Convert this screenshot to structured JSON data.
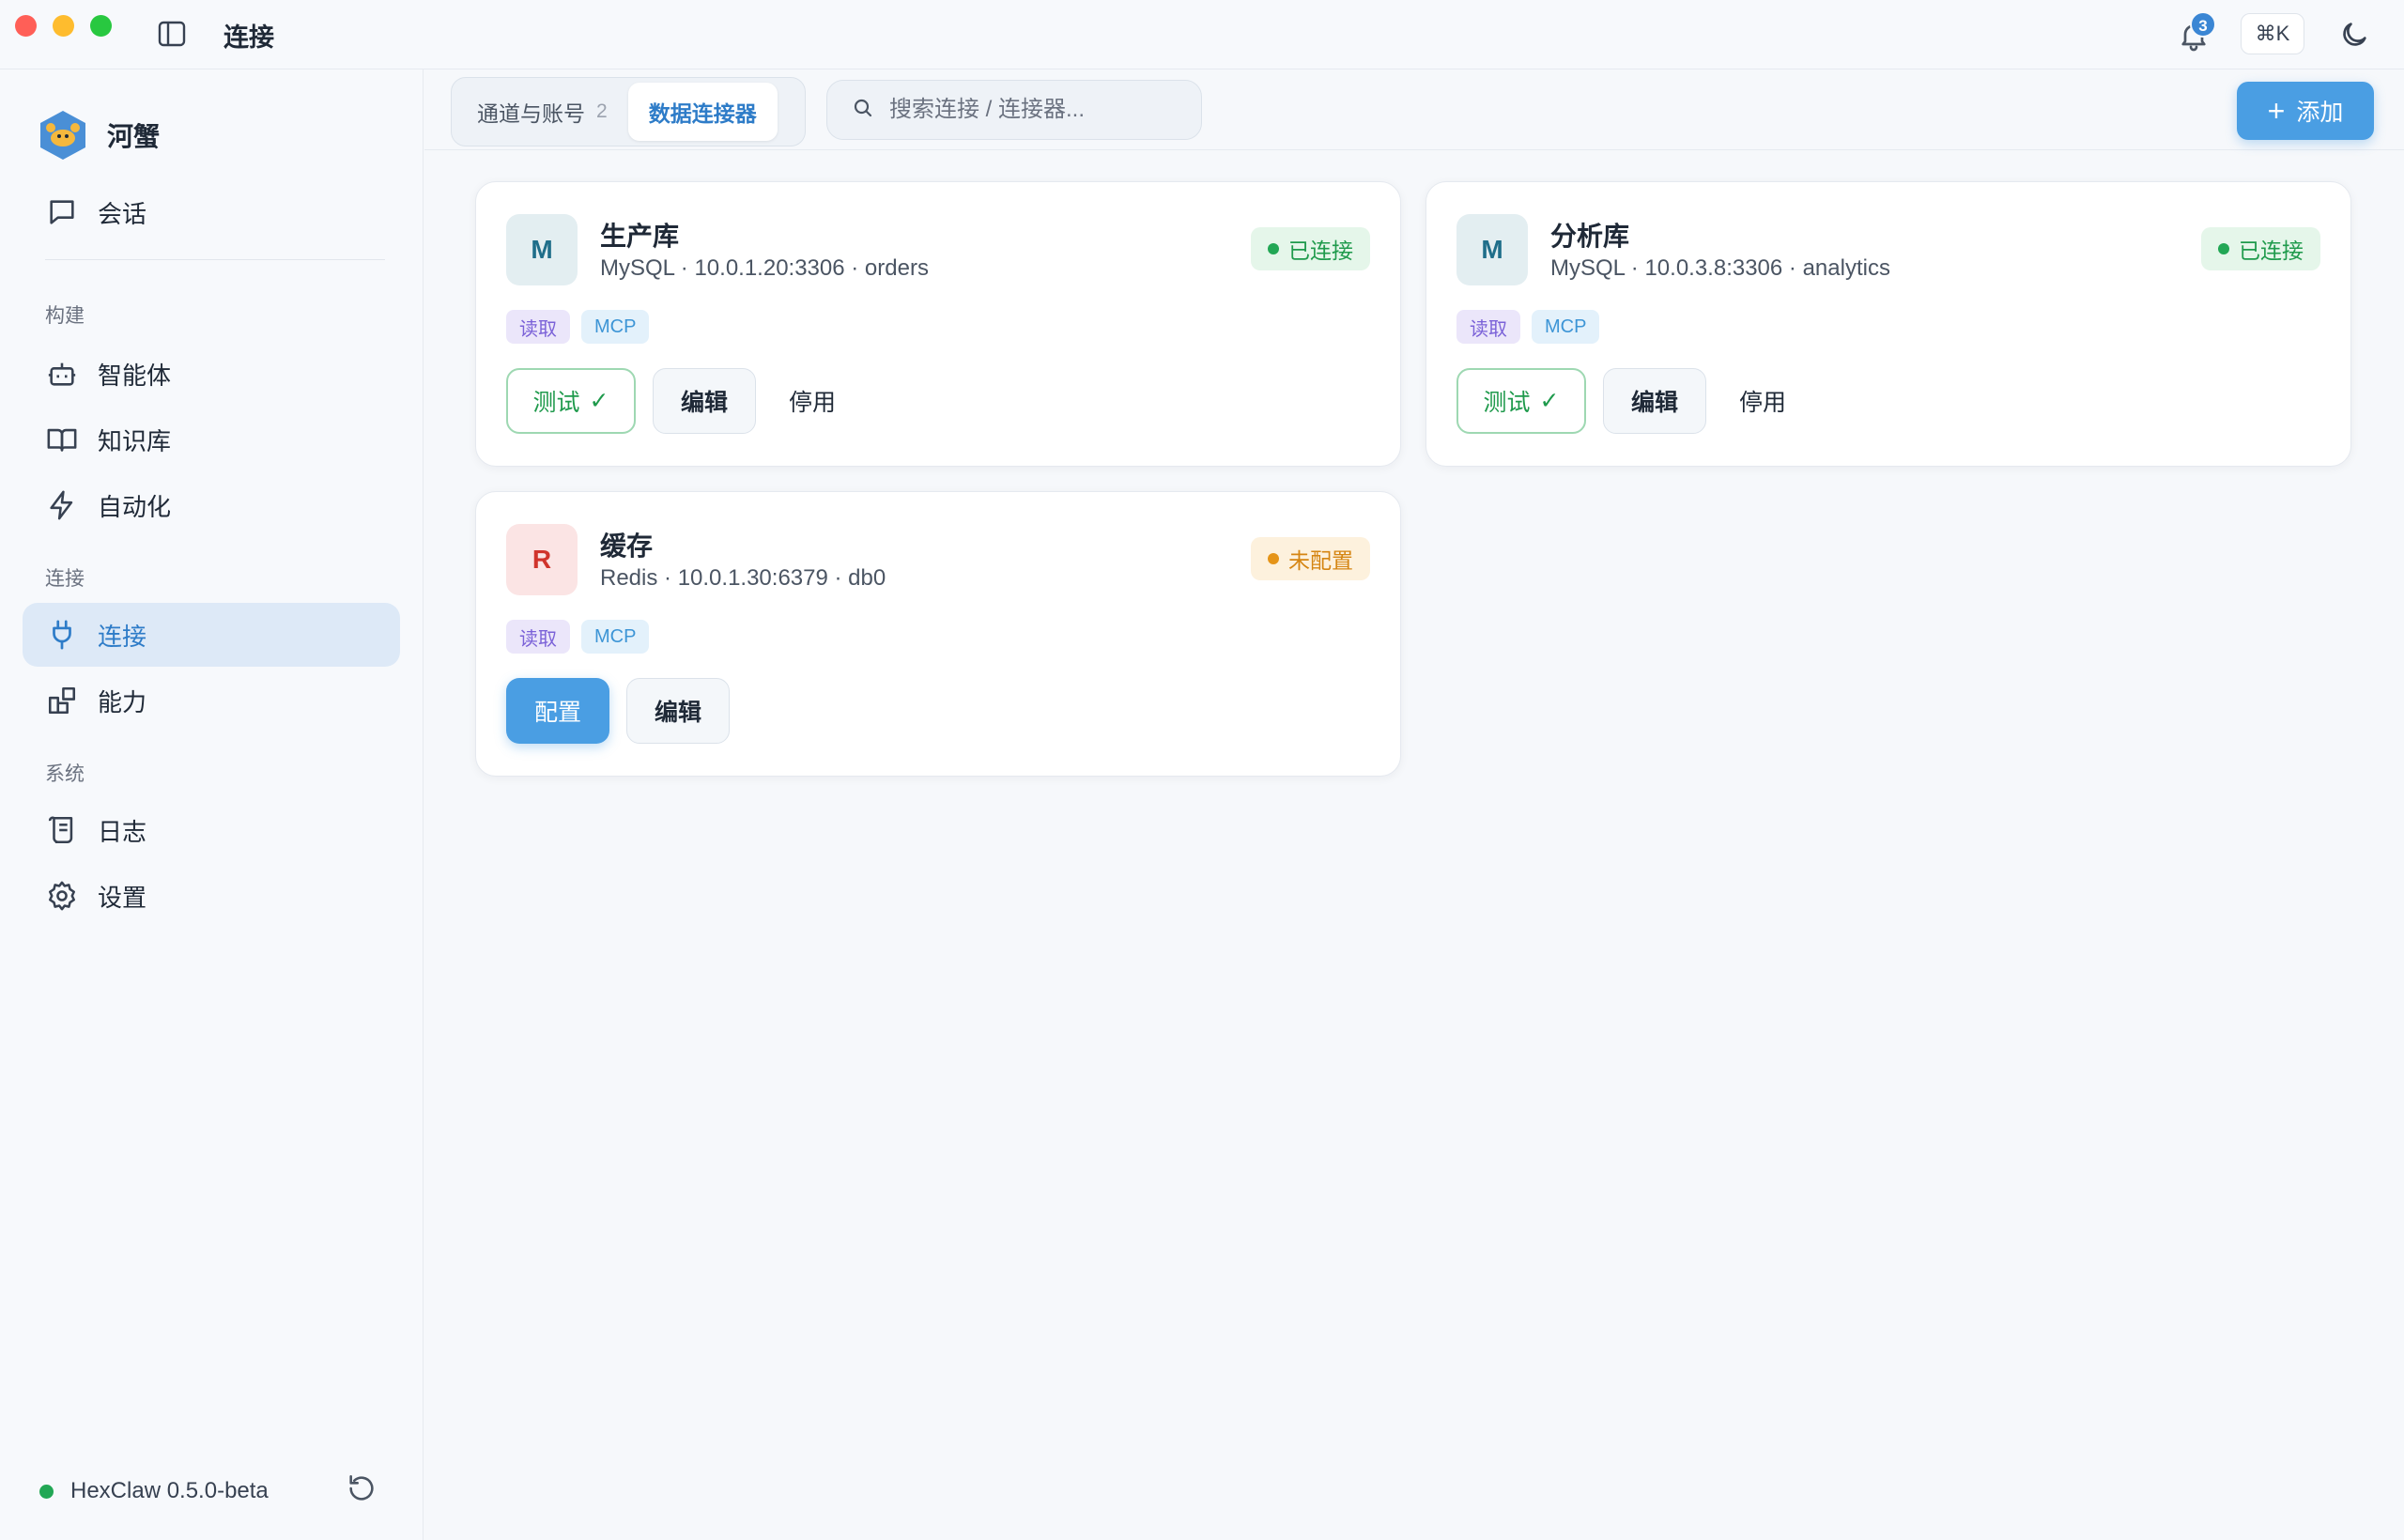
{
  "window": {
    "title": "连接"
  },
  "header": {
    "notification_count": "3",
    "shortcut": "⌘K"
  },
  "brand": {
    "name": "河蟹"
  },
  "sidebar": {
    "chat": "会话",
    "sections": {
      "build": "构建",
      "connect": "连接",
      "system": "系统"
    },
    "items": {
      "agents": "智能体",
      "knowledge": "知识库",
      "automation": "自动化",
      "connections": "连接",
      "capabilities": "能力",
      "logs": "日志",
      "settings": "设置"
    },
    "footer": {
      "version": "HexClaw 0.5.0-beta"
    }
  },
  "toolbar": {
    "tabs": [
      {
        "label": "通道与账号",
        "count": "2"
      },
      {
        "label": "数据连接器"
      }
    ],
    "search": {
      "placeholder": "搜索连接 / 连接器..."
    },
    "add_label": "添加"
  },
  "connectors": [
    {
      "initial": "M",
      "name": "生产库",
      "desc": "MySQL · 10.0.1.20:3306 · orders",
      "status": "已连接",
      "tags": [
        "读取",
        "MCP"
      ],
      "actions": {
        "test": "测试",
        "check": "✓",
        "edit": "编辑",
        "disable": "停用"
      }
    },
    {
      "initial": "M",
      "name": "分析库",
      "desc": "MySQL · 10.0.3.8:3306 · analytics",
      "status": "已连接",
      "tags": [
        "读取",
        "MCP"
      ],
      "actions": {
        "test": "测试",
        "check": "✓",
        "edit": "编辑",
        "disable": "停用"
      }
    },
    {
      "initial": "R",
      "name": "缓存",
      "desc": "Redis · 10.0.1.30:6379 · db0",
      "status": "未配置",
      "tags": [
        "读取",
        "MCP"
      ],
      "actions": {
        "configure": "配置",
        "edit": "编辑"
      }
    }
  ],
  "colors": {
    "accent": "#4a9ee3",
    "connected": "#22a755",
    "unconfigured": "#e59418",
    "active_nav_bg": "#dde9f7"
  },
  "icons": {
    "sidebar_toggle": "sidebar-toggle-icon",
    "bell": "bell-icon",
    "theme": "moon-icon",
    "chat": "chat-icon",
    "agents": "robot-icon",
    "knowledge": "book-icon",
    "automation": "lightning-icon",
    "connections": "plug-icon",
    "capabilities": "blocks-icon",
    "logs": "scroll-icon",
    "settings": "gear-icon",
    "search": "search-icon",
    "refresh": "refresh-icon"
  }
}
